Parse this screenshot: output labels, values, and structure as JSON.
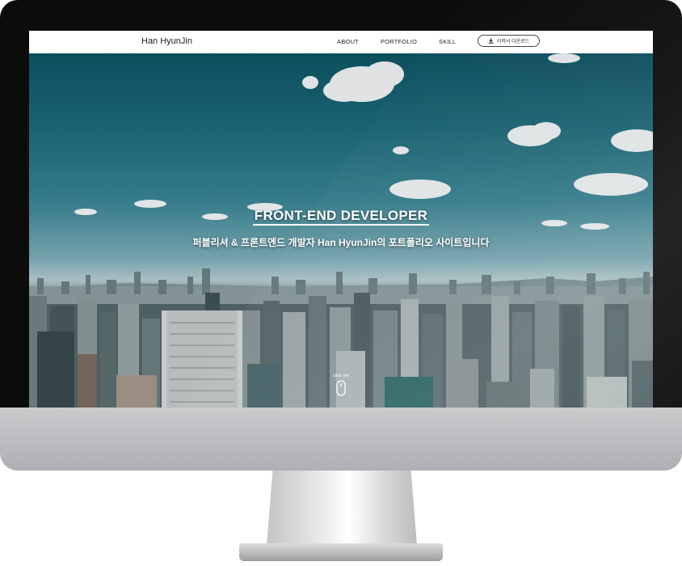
{
  "nav": {
    "logo": "Han HyunJin",
    "links": [
      {
        "label": "ABOUT"
      },
      {
        "label": "PORTFOLIO"
      },
      {
        "label": "SKILL"
      }
    ],
    "resume_button": {
      "label": "이력서 다운로드",
      "icon": "download-icon"
    }
  },
  "hero": {
    "title": "FRONT-END DEVELOPER",
    "subtitle": "퍼블리셔 & 프론트엔드 개발자 Han HyunJin의 포트폴리오 사이트입니다",
    "scroll_hint": {
      "label": "click me",
      "icon": "mouse-icon"
    }
  },
  "colors": {
    "navbar_bg": "#ffffff",
    "sky_top": "#0f5566",
    "text_light": "#ffffff",
    "bezel": "#0c0c0c",
    "stand": "#c9cbcd"
  }
}
